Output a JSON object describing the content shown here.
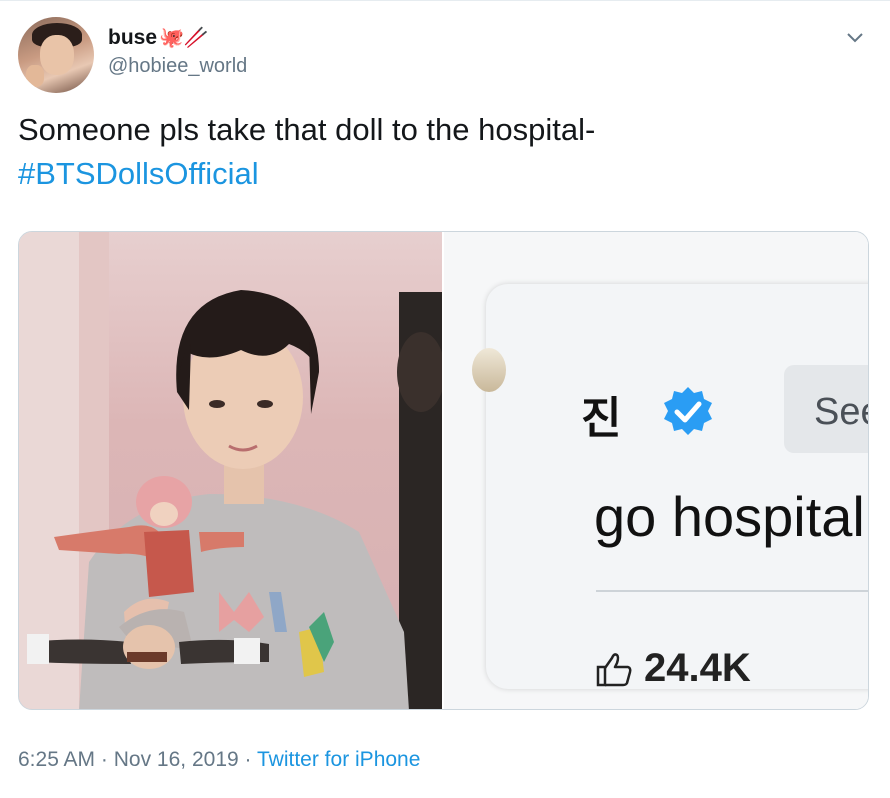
{
  "tweet": {
    "author": {
      "display_name": "buse",
      "name_emoji": "🐙🥢",
      "handle": "@hobiee_world"
    },
    "text": "Someone pls take that doll to the hospital-",
    "hashtag": "#BTSDollsOfficial",
    "footer": {
      "time": "6:25 AM",
      "separator_1": "·",
      "date": "Nov 16, 2019",
      "separator_2": "·",
      "source": "Twitter for iPhone"
    }
  },
  "media_right": {
    "name": "진",
    "translate_button": "See tr",
    "comment_text": "go hospital p",
    "like_count": "24.4K"
  },
  "icons": {
    "caret": "chevron-down-icon",
    "verified": "verified-badge-icon",
    "like": "thumbs-up-icon"
  },
  "colors": {
    "link": "#1b95e0",
    "secondary_text": "#657786",
    "verified": "#2a9df4"
  }
}
